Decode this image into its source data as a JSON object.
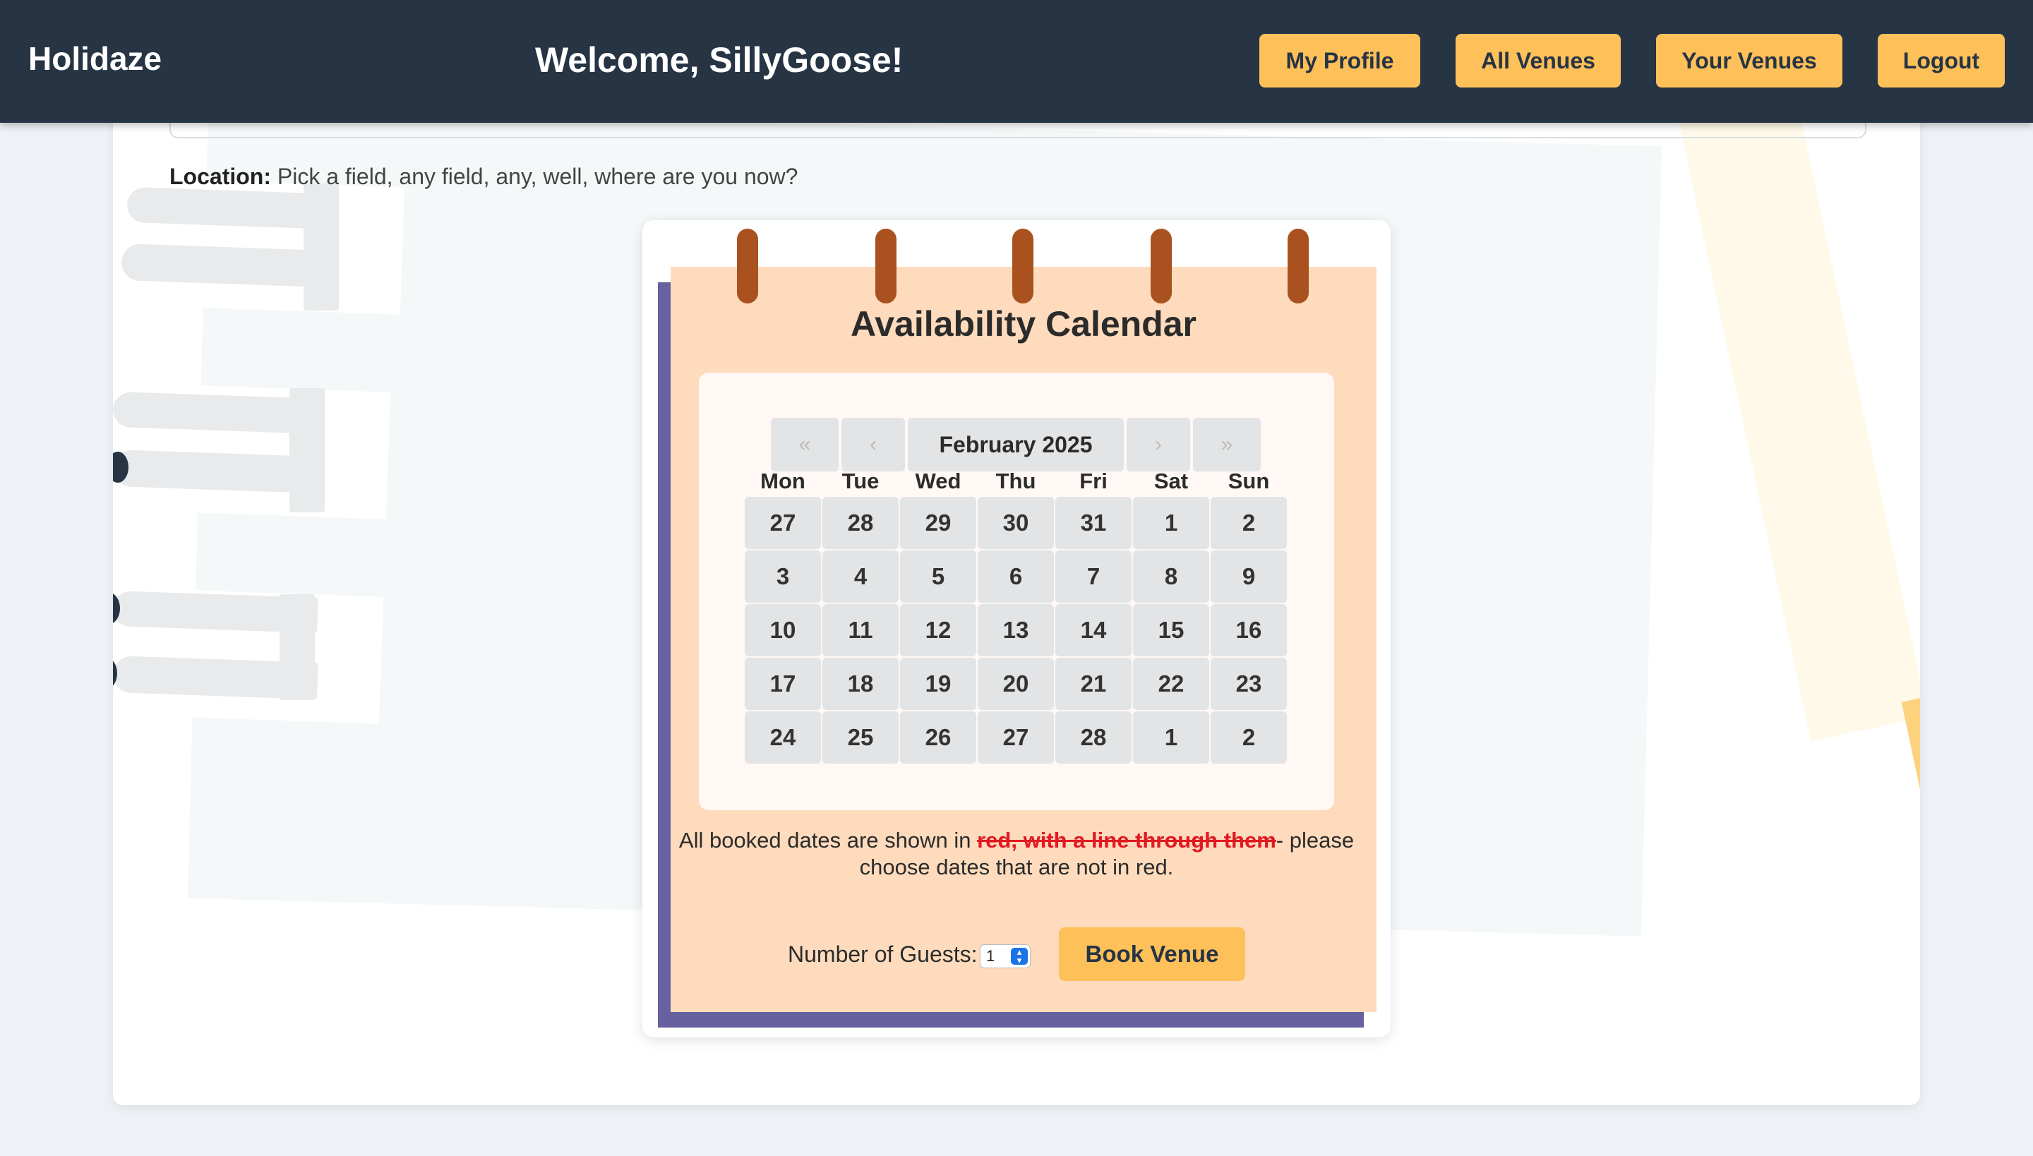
{
  "header": {
    "brand": "Holidaze",
    "welcome": "Welcome, SillyGoose!",
    "nav": [
      "My Profile",
      "All Venues",
      "Your Venues",
      "Logout"
    ]
  },
  "venue": {
    "location_label": "Location:",
    "location_value": " Pick a field, any field, any, well, where are you now?"
  },
  "calendar": {
    "title": "Availability Calendar",
    "nav_first": "«",
    "nav_prev": "‹",
    "month": "February 2025",
    "nav_next": "›",
    "nav_last": "»",
    "weekdays": [
      "Mon",
      "Tue",
      "Wed",
      "Thu",
      "Fri",
      "Sat",
      "Sun"
    ],
    "weeks": [
      [
        "27",
        "28",
        "29",
        "30",
        "31",
        "1",
        "2"
      ],
      [
        "3",
        "4",
        "5",
        "6",
        "7",
        "8",
        "9"
      ],
      [
        "10",
        "11",
        "12",
        "13",
        "14",
        "15",
        "16"
      ],
      [
        "17",
        "18",
        "19",
        "20",
        "21",
        "22",
        "23"
      ],
      [
        "24",
        "25",
        "26",
        "27",
        "28",
        "1",
        "2"
      ]
    ]
  },
  "booking_note": {
    "prefix": "All booked dates are shown in ",
    "booked_style": "red, with a line through them",
    "suffix": "- please choose dates that are not in red."
  },
  "booking": {
    "guests_label": "Number of Guests:",
    "guests_value": "1",
    "book_label": "Book Venue"
  },
  "colors": {
    "header_bg": "#263444",
    "accent": "#fec059",
    "calendar_page": "#ffdbbd",
    "calendar_ring": "#a9521f",
    "booked_red": "#e01922"
  }
}
